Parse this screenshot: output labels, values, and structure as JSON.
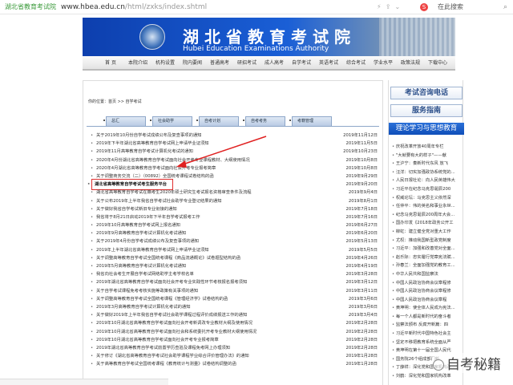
{
  "browser": {
    "site_name": "湖北省教育考试院",
    "url_host": "www.hbea.edu.cn",
    "url_path": "/html/zxks/index.shtml",
    "search_label": "在此搜索"
  },
  "banner": {
    "title": "湖北省教育考试院",
    "subtitle": "Hubei Education Examinations Authority"
  },
  "nav": [
    "首 页",
    "本院介绍",
    "机构设置",
    "院内要闻",
    "普通高考",
    "研招考试",
    "成人高考",
    "自学考试",
    "英语考试",
    "综合考试",
    "学业水平",
    "政策法规",
    "下载中心"
  ],
  "breadcrumb": "你的位置：首页 >> 自学考试",
  "tabs": [
    "总汇",
    "社会助学",
    "自考计划",
    "自考考务",
    "考籍管理"
  ],
  "news": [
    {
      "title": "关于2019年10月份自学考试成绩公布及复查事项的通知",
      "date": "2019年11月12日"
    },
    {
      "title": "2019年下半年湖北省高等教育自学考试网上申请毕业证须知",
      "date": "2019年11月5日"
    },
    {
      "title": "2019年11月高等教育自学考试计算机化考试的通知",
      "date": "2019年10月23日"
    },
    {
      "title": "2020年4月份湖北省高等教育自学考试面向社会开考专业课程教材、大纲使用情况",
      "date": "2019年10月8日"
    },
    {
      "title": "2020年4月湖北省高等教育自学考试面向社会开考专业报考简章",
      "date": "2019年10月8日"
    },
    {
      "title": "关于调整商务交流（二）（00892）全国统考课程试卷结构的函",
      "date": "2019年9月29日"
    },
    {
      "title": "湖北省高等教育自学考试考生服务平台",
      "date": "2019年9月20日",
      "highlight": true
    },
    {
      "title": "湖北省高等教育自学考试在籍考生2020年硕士研究生考试报名资格审查条件及流程",
      "date": "2019年9月4日"
    },
    {
      "title": "关于公布2019年上半年我省自学考试社会助学专业登记结果的通知",
      "date": "2019年8月1日"
    },
    {
      "title": "关于做好我省自学考试新旧专业衔接的通知",
      "date": "2019年7月18日"
    },
    {
      "title": "我省将于8月21日启动2019年下半年自学考试报考工作",
      "date": "2019年7月16日"
    },
    {
      "title": "2019年10月高等教育自学考试网上报名通知",
      "date": "2019年6月27日"
    },
    {
      "title": "2019年9月高等教育自学考试计算机化考试通知",
      "date": "2019年6月20日"
    },
    {
      "title": "关于2019年4月份自学考试成绩公布及复查事项的通知",
      "date": "2019年5月13日"
    },
    {
      "title": "2019年上半年湖北省高等教育自学考试网上申请毕业证须知",
      "date": "2019年5月5日"
    },
    {
      "title": "关于调整高等教育自学考试全国统考课程《商品流通概论》试卷题型结构的函",
      "date": "2019年4月26日"
    },
    {
      "title": "2019年5月高等教育自学考试计算机化考试通知",
      "date": "2019年4月19日"
    },
    {
      "title": "我省向社会考生开展自学考试网络助学主考学校名单",
      "date": "2019年3月28日"
    },
    {
      "title": "2019年湖北省高等教育自学考试面向社会开考专业实践性环节考核报名报考须知",
      "date": "2019年3月12日"
    },
    {
      "title": "关于自学考试课程免考考核实施等政策有关事项的通知",
      "date": "2019年3月11日"
    },
    {
      "title": "关于调整高等教育自学考试全国统考课程《管理经济学》试卷结构的函",
      "date": "2019年3月6日"
    },
    {
      "title": "2019年3月高等教育自学考试计算机化考试的通知",
      "date": "2019年3月6日"
    },
    {
      "title": "关于做好2019年上半年我省自学考试社会助学课程过程评价成绩报送工作的通知",
      "date": "2019年3月4日"
    },
    {
      "title": "2019年10月湖北省高等教育自学考试面向社会开考新调改专业教材大纲及使用情况",
      "date": "2019年2月28日"
    },
    {
      "title": "2019年10月湖北省高等教育自学考试面向社会和系统委托开考专业教材大纲使用情况",
      "date": "2019年2月28日"
    },
    {
      "title": "2019年10月湖北省高等教育自学考试面向社会开考专业报考简章",
      "date": "2019年2月28日"
    },
    {
      "title": "2019年湖北省高等教育自学考试前置学历查验及课程免考网上办理须知",
      "date": "2019年2月28日"
    },
    {
      "title": "关于修订《湖北省高等教育自学考试社会助学课程学业综合评价管理办法》的通知",
      "date": "2019年1月28日"
    },
    {
      "title": "关于高等教育自学考试全国统考课程《教育统计与测量》试卷结构调整的函",
      "date": "2019年1月28日"
    }
  ],
  "sidebar": {
    "btn_phone": "考试咨询电话",
    "btn_guide": "服务指南",
    "header": "理论学习与思想教育",
    "items": [
      "庆祝改革开放40周年专栏",
      "\"大就要有大的样子\"——献",
      "王沪宁：奏新时代东风 放飞",
      "汪洋：切实加强政协系统党的...",
      "人民日报社论：向人民英雄伟大",
      "习近平在纪念马克思诞辰200",
      "权威论坛：马克思主义依然深",
      "任仲平：伟的英名和事业永世...",
      "纪念马克思诞辰200周年大会...",
      "国办印发《2018年政务公开工",
      "柳虹：建立健全党对重大工作",
      "尤权：推动我国新型政党制度",
      "习近平：加强和改善党对全面...",
      "赵乐际：忠实履行党章宪法赋...",
      "孙春兰：全面加强党的教育工...",
      "中华人民共和国监察法",
      "中国人民政治协商会议章程修",
      "中国人民政治协商会议章程修",
      "中国人民政治协商会议章程",
      "黄坤明：使全体人民成为宪法...",
      "每一个人都是新时代的奋斗者",
      "监察法颁布 反腐开新篇：四",
      "习近平新时代中国特色社会主",
      "坚定不移把教育系统全面从严",
      "黄坤明在第十一届全国人民代",
      "国务院26个组成部门新",
      "丁薛祥：深化党和国家机构改...",
      "刘鹤：深化党和国家机构改革"
    ]
  },
  "watermark": "自考秘籍"
}
